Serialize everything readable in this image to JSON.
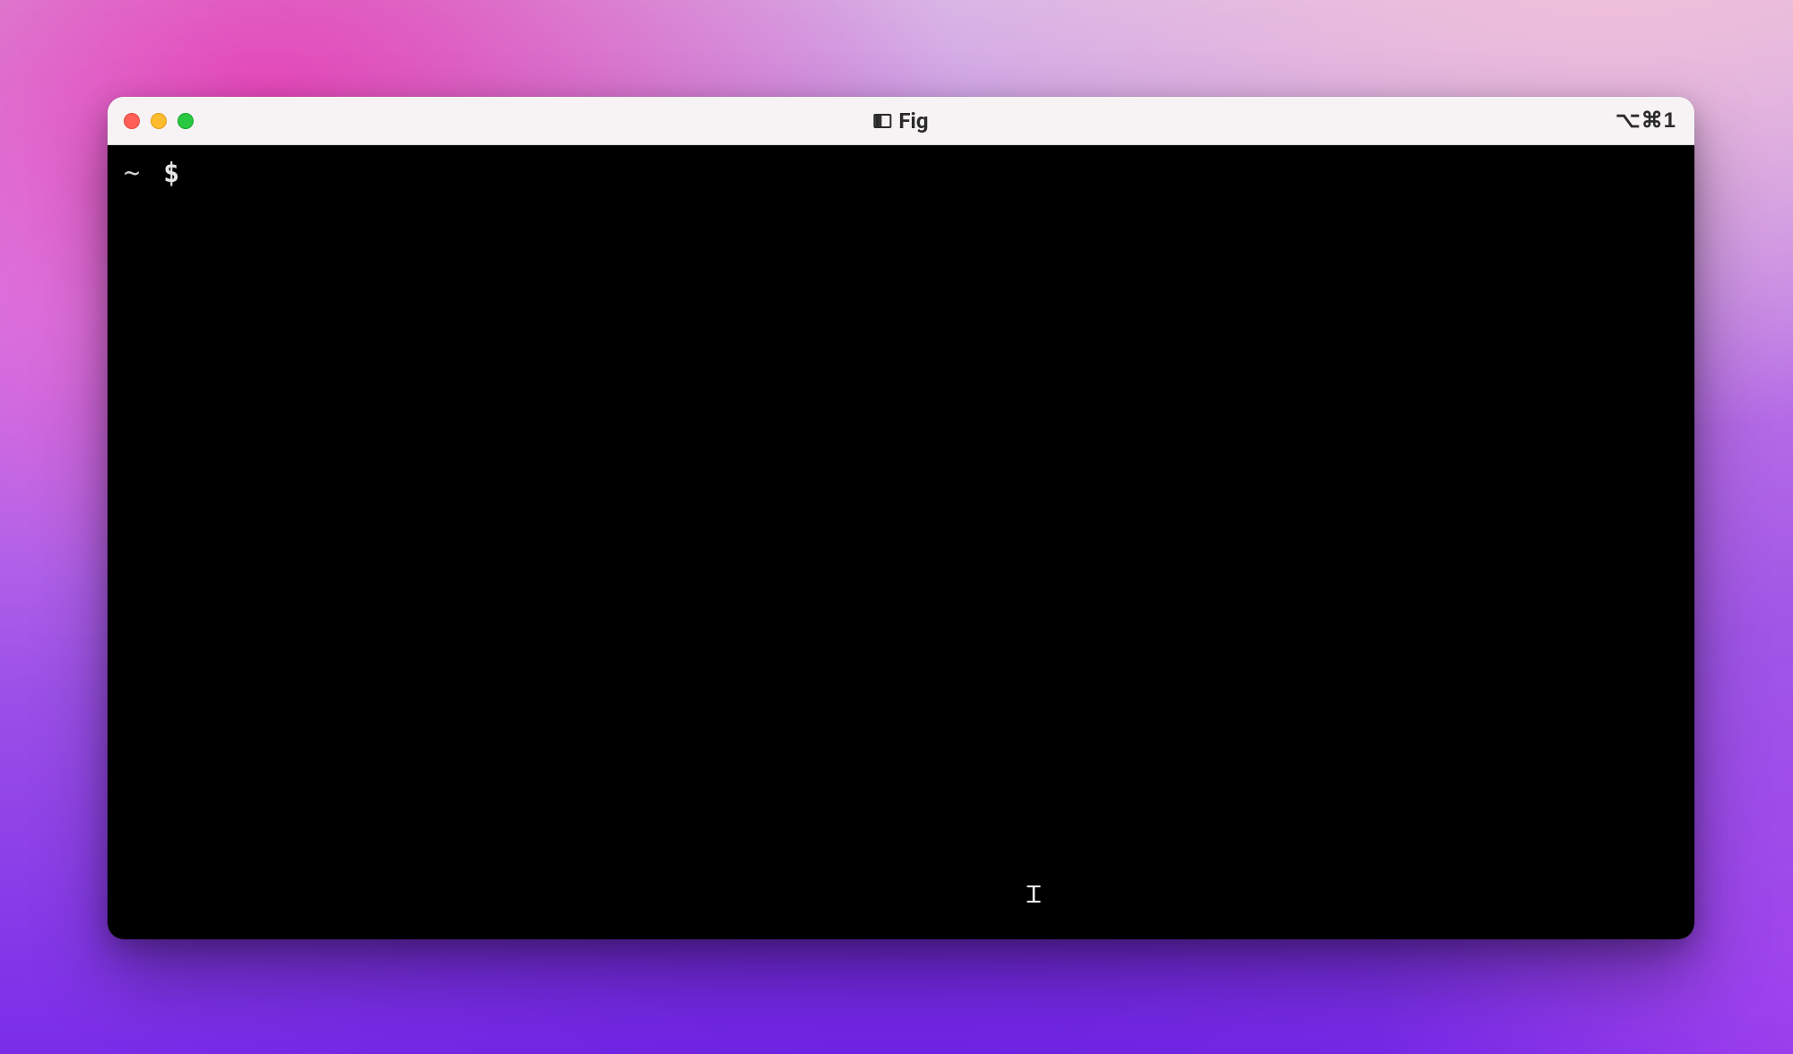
{
  "window": {
    "title": "Fig",
    "shortcut_hint": "⌥⌘1"
  },
  "terminal": {
    "prompt_path": "~",
    "prompt_symbol": "$",
    "input_value": ""
  }
}
